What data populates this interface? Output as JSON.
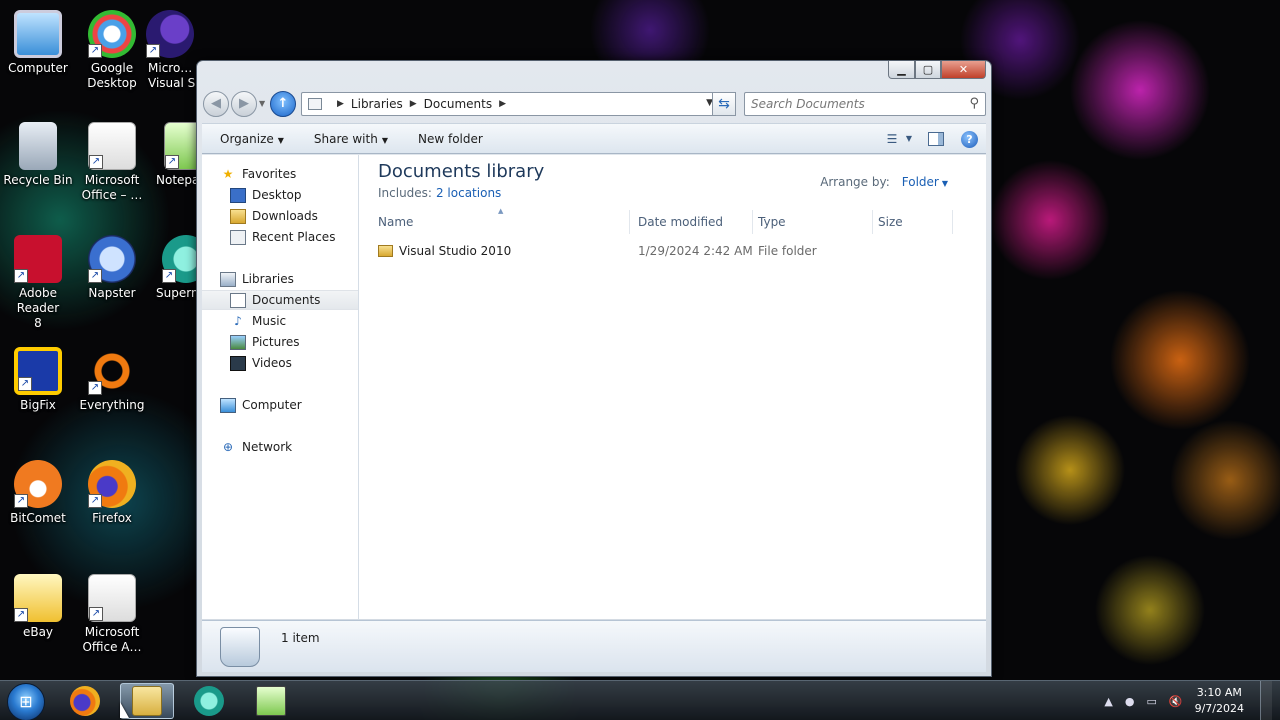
{
  "desktop": {
    "icons": [
      {
        "label": "Computer",
        "icon": "computer-icon"
      },
      {
        "label": "Google Desktop",
        "icon": "google-desktop-icon"
      },
      {
        "label": "Micro… Visual S…",
        "icon": "visual-studio-icon"
      },
      {
        "label": "Recycle Bin",
        "icon": "recycle-bin-icon"
      },
      {
        "label": "Microsoft Office – …",
        "icon": "office-icon"
      },
      {
        "label": "Notepa…",
        "icon": "notepad-icon"
      },
      {
        "label": "Adobe Reader 8",
        "icon": "adobe-reader-icon"
      },
      {
        "label": "Napster",
        "icon": "napster-icon"
      },
      {
        "label": "Superm…",
        "icon": "superm-icon"
      },
      {
        "label": "BigFix",
        "icon": "bigfix-icon"
      },
      {
        "label": "Everything",
        "icon": "everything-icon"
      },
      {
        "label": "BitComet",
        "icon": "bitcomet-icon"
      },
      {
        "label": "Firefox",
        "icon": "firefox-icon"
      },
      {
        "label": "eBay",
        "icon": "ebay-icon"
      },
      {
        "label": "Microsoft Office A…",
        "icon": "office-a-icon"
      }
    ]
  },
  "window": {
    "address": {
      "crumbs": [
        "Libraries",
        "Documents"
      ]
    },
    "search": {
      "placeholder": "Search Documents"
    },
    "toolbar": {
      "organize": "Organize",
      "share_with": "Share with",
      "new_folder": "New folder"
    },
    "nav": {
      "favorites": "Favorites",
      "desktop": "Desktop",
      "downloads": "Downloads",
      "recent_places": "Recent Places",
      "libraries": "Libraries",
      "documents": "Documents",
      "music": "Music",
      "pictures": "Pictures",
      "videos": "Videos",
      "computer": "Computer",
      "network": "Network"
    },
    "library": {
      "title": "Documents library",
      "includes_label": "Includes:",
      "locations_link": "2 locations",
      "arrange_label": "Arrange by:",
      "arrange_value": "Folder"
    },
    "columns": {
      "name": "Name",
      "date": "Date modified",
      "type": "Type",
      "size": "Size"
    },
    "files": [
      {
        "name": "Visual Studio 2010",
        "date": "1/29/2024 2:42 AM",
        "type": "File folder",
        "size": ""
      }
    ],
    "details": {
      "count": "1 item"
    }
  },
  "taskbar": {
    "time": "3:10 AM",
    "date": "9/7/2024"
  }
}
